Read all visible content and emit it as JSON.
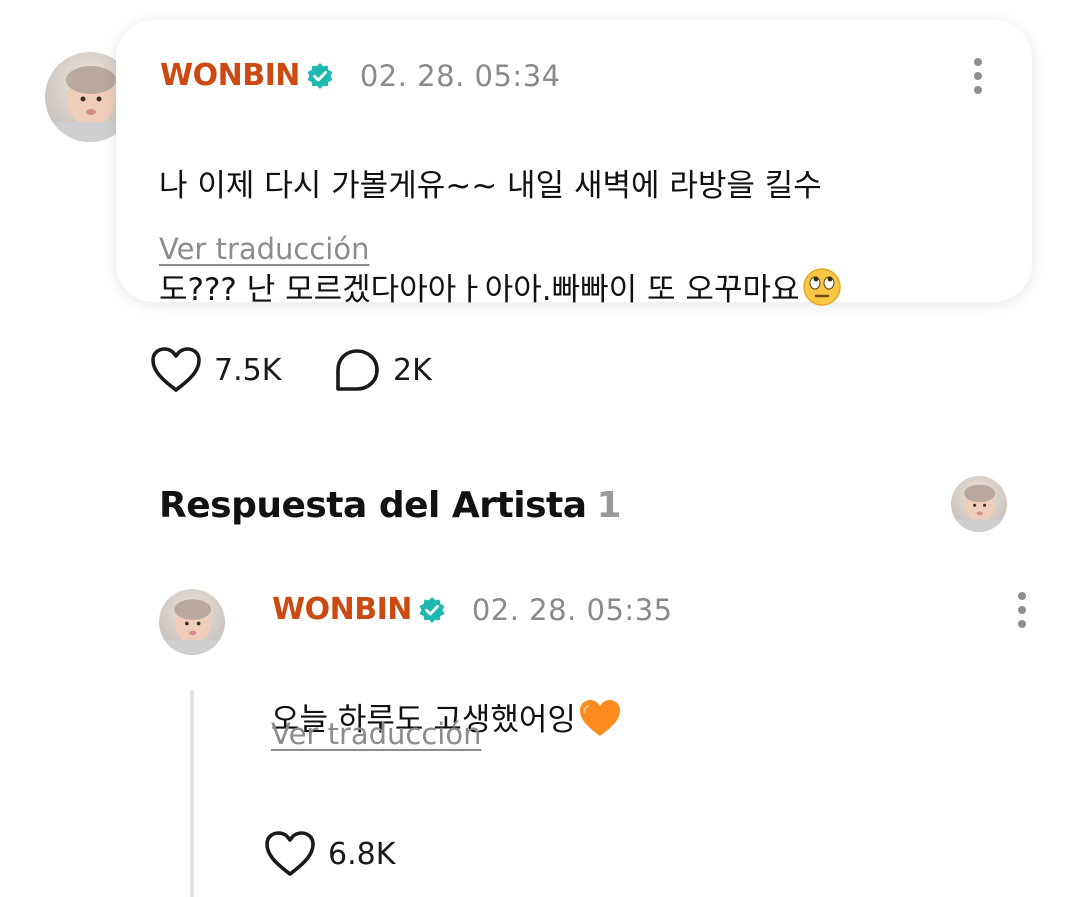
{
  "post": {
    "author": "WONBIN",
    "timestamp": "02. 28. 05:34",
    "text_line1": "나 이제 다시 가볼게유~~ 내일 새벽에 라방을 킬수",
    "text_line2": "도??? 난 모르겠다아아ㅏ아아.빠빠이 또 오꾸마요",
    "text_emoji": "face-with-rolling-eyes",
    "translate_label": "Ver traducción",
    "likes": "7.5K",
    "comments": "2K"
  },
  "replies": {
    "title": "Respuesta del Artista",
    "count": "1"
  },
  "reply": {
    "author": "WONBIN",
    "timestamp": "02. 28. 05:35",
    "text": "오늘 하루도 고생했어잉",
    "text_emoji": "orange-heart",
    "translate_label": "Ver traducción",
    "likes": "6.8K"
  },
  "colors": {
    "author": "#cc4a12",
    "verified": "#1fb8b0",
    "meta": "#8a8a8a"
  }
}
